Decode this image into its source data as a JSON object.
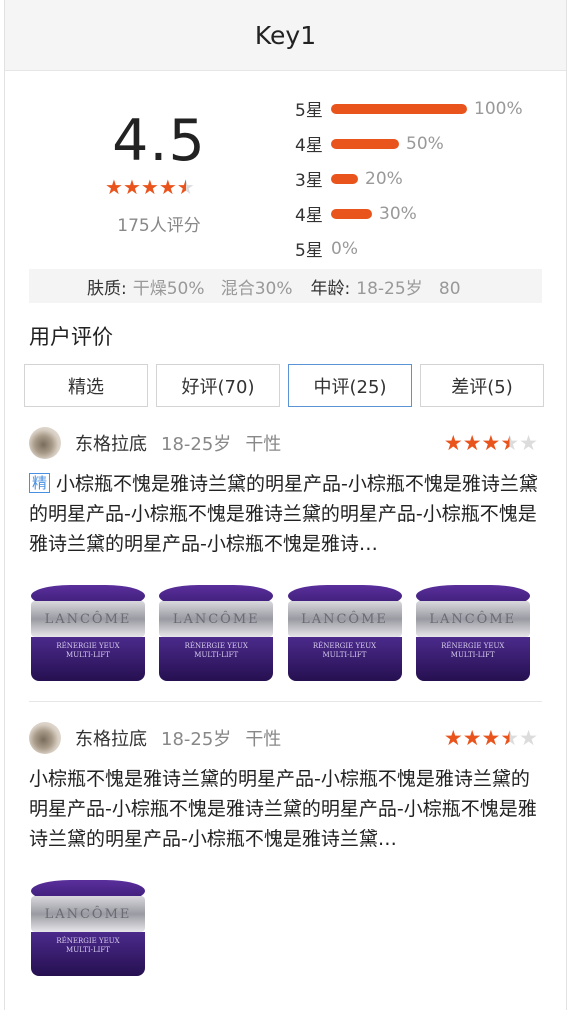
{
  "header": {
    "title": "Key1"
  },
  "rating": {
    "score": "4.5",
    "stars": 4.5,
    "count_label": "175人评分",
    "distribution": [
      {
        "label": "5星",
        "pct": "100%",
        "fraction": 1.0
      },
      {
        "label": "4星",
        "pct": "50%",
        "fraction": 0.5
      },
      {
        "label": "3星",
        "pct": "20%",
        "fraction": 0.2
      },
      {
        "label": "4星",
        "pct": "30%",
        "fraction": 0.3
      },
      {
        "label": "5星",
        "pct": "0%",
        "fraction": 0.0
      }
    ]
  },
  "profile": {
    "skin_label": "肤质:",
    "skin_values": "干燥50%   混合30%",
    "age_label": "年龄:",
    "age_values": "18-25岁   80"
  },
  "reviews_section": {
    "title": "用户评价",
    "tabs": [
      {
        "label": "精选",
        "active": false
      },
      {
        "label": "好评(70)",
        "active": false
      },
      {
        "label": "中评(25)",
        "active": true
      },
      {
        "label": "差评(5)",
        "active": false
      }
    ]
  },
  "reviews": [
    {
      "user": "东格拉底",
      "age": "18-25岁",
      "skin": "干性",
      "stars": 3.5,
      "tag": "精",
      "text": "小棕瓶不愧是雅诗兰黛的明星产品-小棕瓶不愧是雅诗兰黛的明星产品-小棕瓶不愧是雅诗兰黛的明星产品-小棕瓶不愧是雅诗兰黛的明星产品-小棕瓶不愧是雅诗…",
      "photo_count": 4
    },
    {
      "user": "东格拉底",
      "age": "18-25岁",
      "skin": "干性",
      "stars": 3.5,
      "text": "小棕瓶不愧是雅诗兰黛的明星产品-小棕瓶不愧是雅诗兰黛的明星产品-小棕瓶不愧是雅诗兰黛的明星产品-小棕瓶不愧是雅诗兰黛的明星产品-小棕瓶不愧是雅诗兰黛…",
      "photo_count": 1
    }
  ],
  "product_photo": {
    "brand": "LANCÔME",
    "line1": "RÉNERGIE YEUX",
    "line2": "MULTI-LIFT"
  },
  "colors": {
    "accent": "#e9541d",
    "active_tab_border": "#5b94d6",
    "tag_blue": "#4a90e2"
  }
}
